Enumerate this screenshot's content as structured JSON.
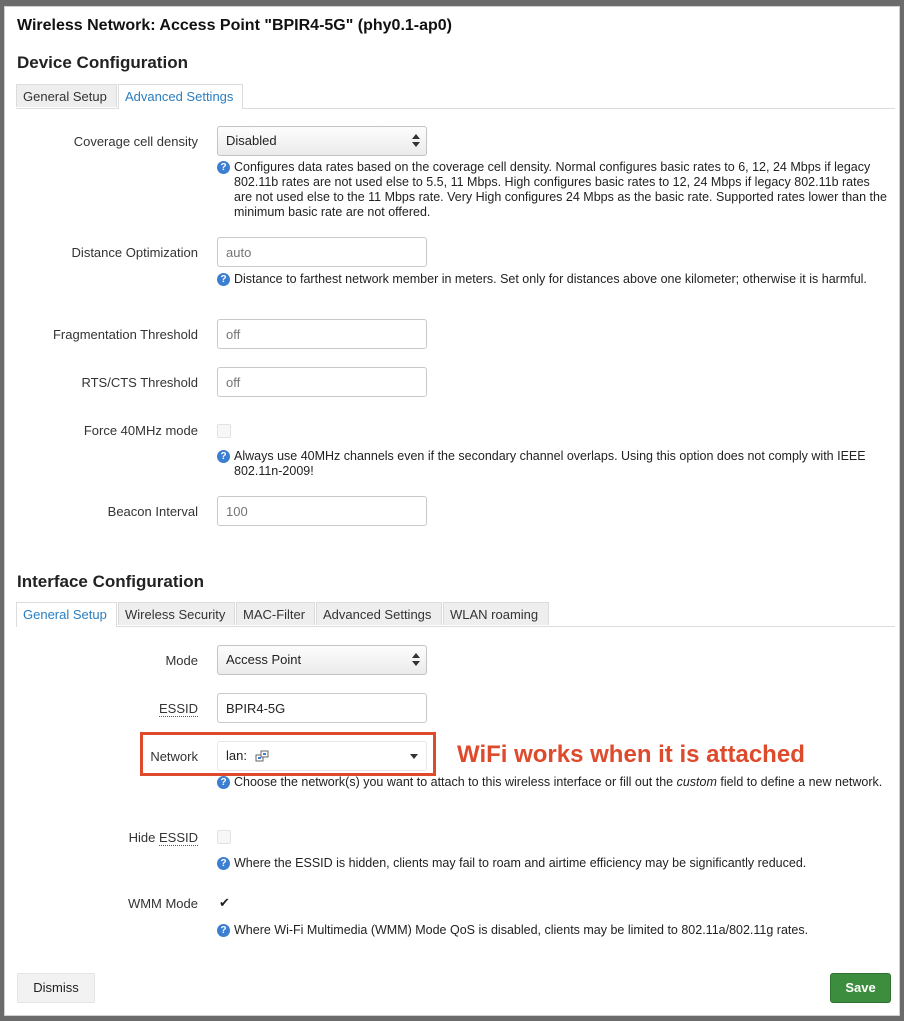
{
  "dialog": {
    "title": "Wireless Network: Access Point \"BPIR4-5G\" (phy0.1-ap0)"
  },
  "device": {
    "section_title": "Device Configuration",
    "tabs": [
      {
        "label": "General Setup",
        "active": false
      },
      {
        "label": "Advanced Settings",
        "active": true
      }
    ],
    "coverage": {
      "label": "Coverage cell density",
      "value": "Disabled",
      "help": "Configures data rates based on the coverage cell density. Normal configures basic rates to 6, 12, 24 Mbps if legacy 802.11b rates are not used else to 5.5, 11 Mbps. High configures basic rates to 12, 24 Mbps if legacy 802.11b rates are not used else to the 11 Mbps rate. Very High configures 24 Mbps as the basic rate. Supported rates lower than the minimum basic rate are not offered."
    },
    "distance": {
      "label": "Distance Optimization",
      "placeholder": "auto",
      "help": "Distance to farthest network member in meters. Set only for distances above one kilometer; otherwise it is harmful."
    },
    "frag": {
      "label": "Fragmentation Threshold",
      "placeholder": "off"
    },
    "rts": {
      "label": "RTS/CTS Threshold",
      "placeholder": "off"
    },
    "force40": {
      "label": "Force 40MHz mode",
      "checked": false,
      "help": "Always use 40MHz channels even if the secondary channel overlaps. Using this option does not comply with IEEE 802.11n-2009!"
    },
    "beacon": {
      "label": "Beacon Interval",
      "placeholder": "100"
    }
  },
  "iface": {
    "section_title": "Interface Configuration",
    "tabs": [
      {
        "label": "General Setup",
        "active": true
      },
      {
        "label": "Wireless Security",
        "active": false
      },
      {
        "label": "MAC-Filter",
        "active": false
      },
      {
        "label": "Advanced Settings",
        "active": false
      },
      {
        "label": "WLAN roaming",
        "active": false
      }
    ],
    "mode": {
      "label": "Mode",
      "value": "Access Point"
    },
    "essid": {
      "label": "ESSID",
      "value": "BPIR4-5G"
    },
    "network": {
      "label": "Network",
      "value": "lan:",
      "help_before": "Choose the network(s) you want to attach to this wireless interface or fill out the ",
      "help_em": "custom",
      "help_after": " field to define a new network."
    },
    "hide_essid": {
      "label_prefix": "Hide ",
      "label_abbr": "ESSID",
      "checked": false,
      "help": "Where the ESSID is hidden, clients may fail to roam and airtime efficiency may be significantly reduced."
    },
    "wmm": {
      "label": "WMM Mode",
      "checked": true,
      "check_glyph": "✔",
      "help": "Where Wi-Fi Multimedia (WMM) Mode QoS is disabled, clients may be limited to 802.11a/802.11g rates."
    }
  },
  "annotation": {
    "text": "WiFi works when it is attached",
    "color": "#de4a2c"
  },
  "footer": {
    "dismiss_label": "Dismiss",
    "save_label": "Save",
    "save_color": "#3d8d3e"
  },
  "icons": {
    "help": "help-circle-icon",
    "network": "network-ports-icon"
  }
}
